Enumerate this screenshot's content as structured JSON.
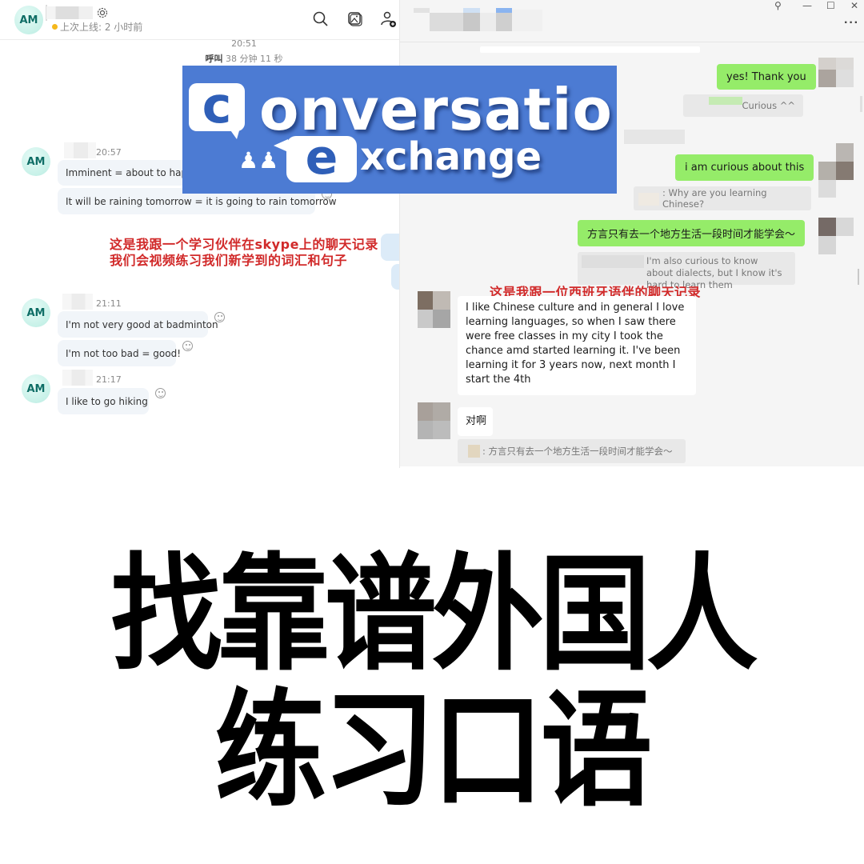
{
  "left_chat": {
    "app": "Skype",
    "contact_initials": "AM",
    "status_text": "上次上线: 2 小时前",
    "status_color": "#f5b81b",
    "header_icons": [
      "search-icon",
      "gallery-icon",
      "add-contact-icon"
    ],
    "call": {
      "time": "20:51",
      "label": "呼叫",
      "duration": "38 分钟 11 秒"
    },
    "groups": [
      {
        "time": "20:57",
        "messages": [
          "Imminent = about to happe",
          "It will be raining tomorrow = it is going to rain tomorrow"
        ]
      },
      {
        "time": "21:11",
        "messages": [
          "I'm not very good at badminton",
          "I'm not too bad = good!"
        ]
      },
      {
        "time": "21:17",
        "messages": [
          "I like to go hiking"
        ]
      }
    ],
    "annotation_line1_pre": "这是我跟一个学习伙伴在",
    "annotation_line1_brand": "skype",
    "annotation_line1_post": "上的聊天记录",
    "annotation_line2": "我们会视频练习我们新学到的词汇和句子"
  },
  "logo": {
    "letter_c": "c",
    "word1": "onversation",
    "letter_e": "e",
    "word2": "xchange",
    "bg_color": "#4c7bd3"
  },
  "right_chat": {
    "app": "WeChat",
    "window_controls": {
      "pin": "⚲",
      "minimize": "—",
      "maximize": "☐",
      "close": "✕",
      "more": "···"
    },
    "messages": [
      {
        "type": "sent",
        "text": "yes! Thank you"
      },
      {
        "type": "quote",
        "text": "Curious ^^"
      },
      {
        "type": "sent",
        "text": "i am curious about this"
      },
      {
        "type": "quote",
        "text": ": Why are you learning Chinese?"
      },
      {
        "type": "sent",
        "text": "方言只有去一个地方生活一段时间才能学会～"
      },
      {
        "type": "quote",
        "text": "I'm also curious to know about dialects, but I know it's hard to learn them"
      },
      {
        "type": "received",
        "text": " I like Chinese culture and in general I love learning languages, so when I saw there were free classes in my city I took the chance amd started learning it. I've been learning it for 3 years now, next month I start the 4th"
      },
      {
        "type": "received",
        "text": "对啊"
      },
      {
        "type": "quote",
        "text": ": 方言只有去一个地方生活一段时间才能学会～"
      }
    ],
    "annotation": "这是我跟一位西班牙语伴的聊天记录",
    "sent_color": "#95ec69"
  },
  "title": {
    "line1": "找靠谱外国人",
    "line2": "练习口语"
  }
}
